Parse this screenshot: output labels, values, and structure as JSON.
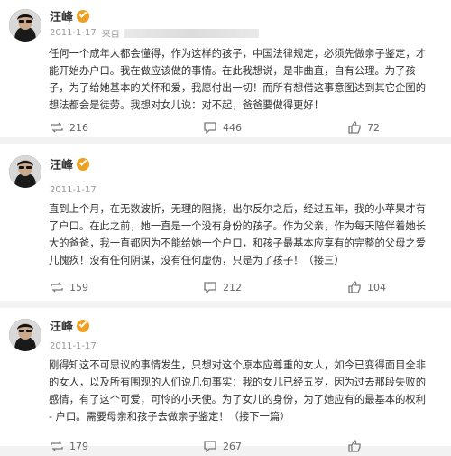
{
  "posts": [
    {
      "author": "汪峰",
      "date": "2011-1-17",
      "source_prefix": "来自",
      "content": "任何一个成年人都会懂得，作为这样的孩子，中国法律规定，必须先做亲子鉴定，才能开始办户口。我在做应该做的事情。在此我想说，是非曲直，自有公理。为了孩子，为了给她基本的关怀和爱，我愿付出一切！而所有想借这事意图达到其它企图的想法都会是徒劳。我想对女儿说：对不起，爸爸要做得更好！",
      "reposts": "216",
      "comments": "446",
      "likes": "72"
    },
    {
      "author": "汪峰",
      "date": "2011-1-17",
      "source_prefix": "",
      "content": "直到上个月，在无数波折，无理的阻挠，出尔反尔之后，经过五年，我的小苹果才有了户口。在此之前，她一直是一个没有身份的孩子。作为父亲，作为每天陪伴着她长大的爸爸，我一直都因为不能给她一个户口，和孩子最基本应享有的完整的父母之爱儿愧疚！没有任何阴谋，没有任何虚伪，只是为了孩子！（接三）",
      "reposts": "159",
      "comments": "212",
      "likes": "104"
    },
    {
      "author": "汪峰",
      "date": "2011-1-17",
      "source_prefix": "",
      "content": "刚得知这不可思议的事情发生，只想对这个原本应尊重的女人，如今已变得面目全非的女人，以及所有围观的人们说几句事实：我的女儿已经五岁，因为过去那段失败的感情，有了这个可爱，可怜的小天使。为了女儿的身份，为了她应有的最基本的权利 - 户口。需要母亲和孩子去做亲子鉴定！（接下一篇）",
      "reposts": "179",
      "comments": "267",
      "likes": ""
    }
  ],
  "colors": {
    "vip_badge": "#f0a020",
    "text": "#333333",
    "meta": "#999999"
  }
}
